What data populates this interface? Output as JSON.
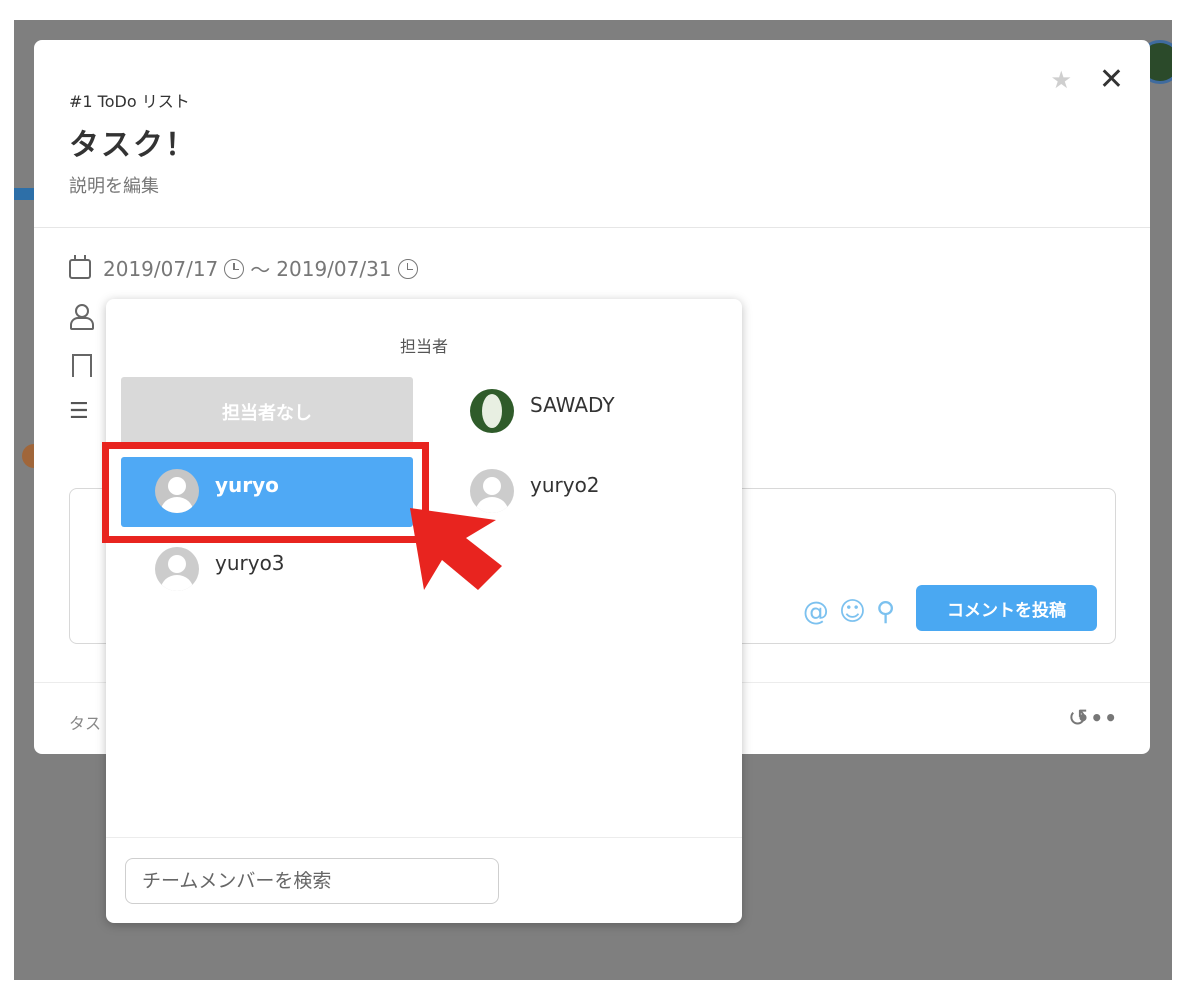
{
  "modal": {
    "list_label": "#1 ToDo リスト",
    "task_title": "タスク！",
    "description": "説明を編集",
    "start_date": "2019/07/17",
    "separator": "〜",
    "end_date": "2019/07/31",
    "comment_button": "コメントを投稿",
    "footer_left": "タス"
  },
  "popover": {
    "title": "担当者",
    "no_assignee": "担当者なし",
    "members": [
      {
        "name": "SAWADY"
      },
      {
        "name": "yuryo"
      },
      {
        "name": "yuryo2"
      },
      {
        "name": "yuryo3"
      }
    ],
    "search_placeholder": "チームメンバーを検索"
  },
  "colors": {
    "accent": "#4fa9f5",
    "annotation": "#e8241f"
  }
}
